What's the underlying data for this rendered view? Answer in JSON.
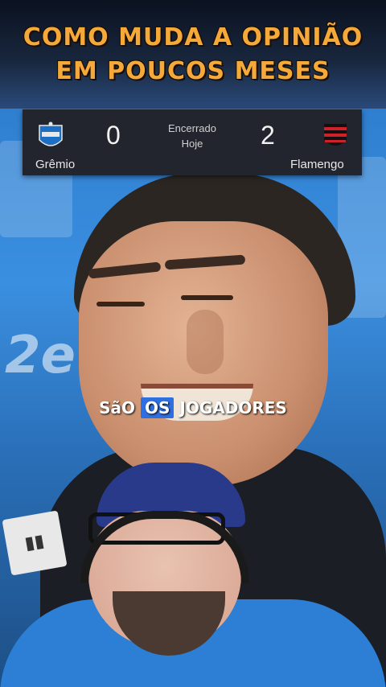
{
  "overlay_title": {
    "line1": "COMO MUDA A OPINIÃO",
    "line2": "EM POUCOS MESES"
  },
  "scoreboard": {
    "home_team": "Grêmio",
    "home_score": "0",
    "status": "Encerrado",
    "status_detail": "Hoje",
    "away_score": "2",
    "away_team": "Flamengo"
  },
  "caption": {
    "word1": "SãO",
    "word2": "OS",
    "word3": "JOGADORES"
  },
  "colors": {
    "title": "#f4a93a",
    "caption_highlight": "#2f6fe0",
    "scoreboard_bg": "#22252d"
  }
}
